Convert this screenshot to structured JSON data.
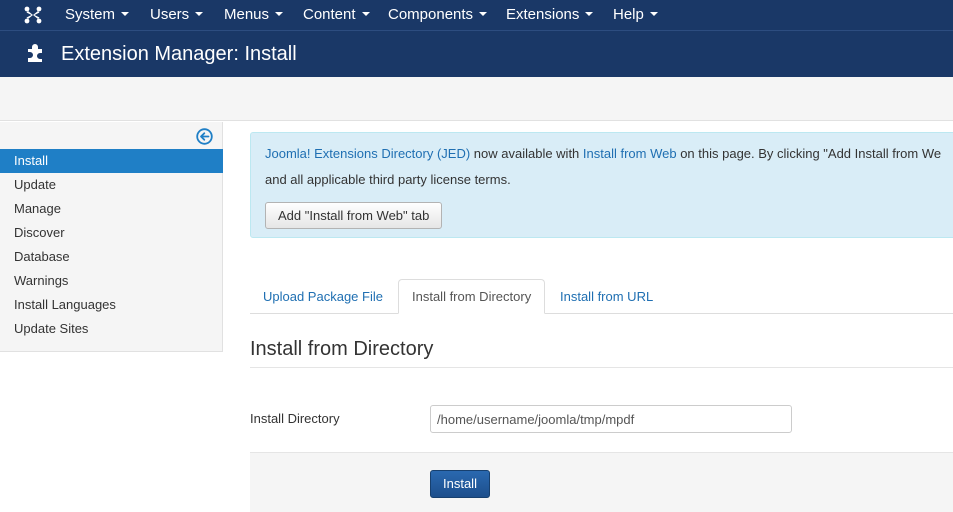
{
  "navbar": {
    "items": [
      {
        "label": "System"
      },
      {
        "label": "Users"
      },
      {
        "label": "Menus"
      },
      {
        "label": "Content"
      },
      {
        "label": "Components"
      },
      {
        "label": "Extensions"
      },
      {
        "label": "Help"
      }
    ],
    "logo_icon": "joomla-logo-icon",
    "background": "#1a3867"
  },
  "header": {
    "title": "Extension Manager: Install",
    "icon": "puzzle-piece-icon"
  },
  "sidebar": {
    "toggle_icon": "arrow-left-circle-icon",
    "items": [
      {
        "label": "Install",
        "active": true
      },
      {
        "label": "Update"
      },
      {
        "label": "Manage"
      },
      {
        "label": "Discover"
      },
      {
        "label": "Database"
      },
      {
        "label": "Warnings"
      },
      {
        "label": "Install Languages"
      },
      {
        "label": "Update Sites"
      }
    ],
    "active_color": "#1f7fc6"
  },
  "alert": {
    "jed_link": "Joomla! Extensions Directory (JED)",
    "text_mid": " now available with ",
    "web_link": "Install from Web",
    "text_end": " on this page.  By clicking \"Add Install from We",
    "line2": "and all applicable third party license terms.",
    "button_label": "Add \"Install from Web\" tab"
  },
  "tabs": [
    {
      "label": "Upload Package File"
    },
    {
      "label": "Install from Directory",
      "active": true
    },
    {
      "label": "Install from URL"
    }
  ],
  "form": {
    "section_title": "Install from Directory",
    "directory_label": "Install Directory",
    "directory_value": "/home/username/joomla/tmp/mpdf",
    "install_button": "Install"
  }
}
